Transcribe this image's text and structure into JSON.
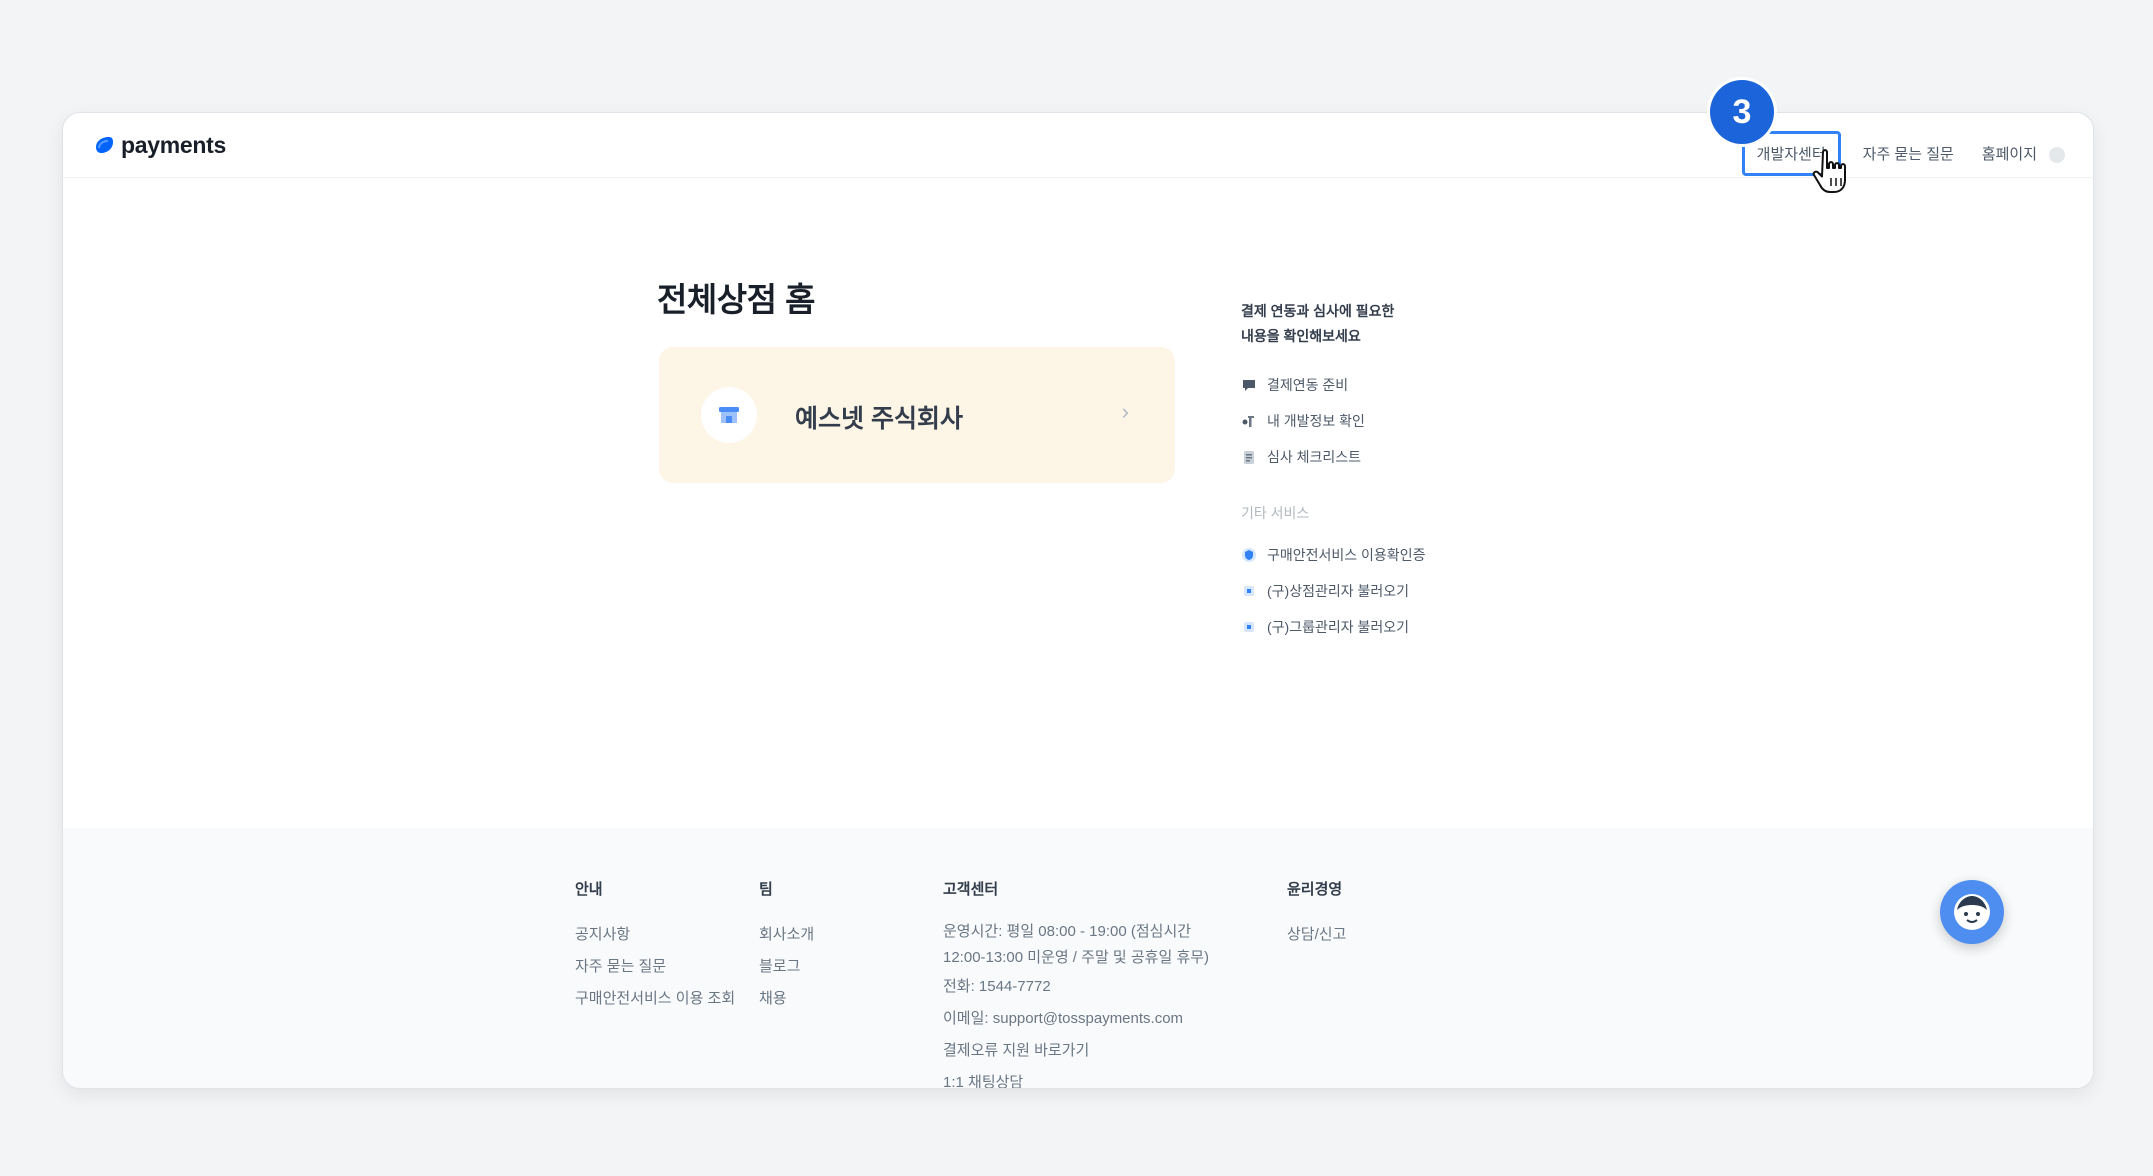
{
  "brand": {
    "logo_text": "payments",
    "logo_icon": "toss-drop-icon",
    "accent": "#3182f6"
  },
  "nav": {
    "items": [
      {
        "label": "개발자센터",
        "highlighted": true
      },
      {
        "label": "자주 묻는 질문"
      },
      {
        "label": "홈페이지"
      }
    ],
    "profile_icon": "user-avatar-icon"
  },
  "tutorial": {
    "step": "3",
    "badge_color": "#1b64da"
  },
  "main": {
    "title": "전체상점 홈",
    "store_card": {
      "name": "예스넷 주식회사",
      "icon": "store-icon",
      "chevron": "›",
      "bg": "#fdf5e6"
    }
  },
  "side": {
    "heading_line1": "결제 연동과 심사에 필요한",
    "heading_line2": "내용을 확인해보세요",
    "items": [
      {
        "label": "결제연동 준비",
        "icon": "chat-bubble-icon"
      },
      {
        "label": "내 개발정보 확인",
        "icon": "key-icon"
      },
      {
        "label": "심사 체크리스트",
        "icon": "clipboard-icon"
      }
    ],
    "other_heading": "기타 서비스",
    "other_items": [
      {
        "label": "구매안전서비스 이용확인증",
        "icon": "shield-icon"
      },
      {
        "label": "(구)상점관리자 불러오기",
        "icon": "import-icon"
      },
      {
        "label": "(구)그룹관리자 불러오기",
        "icon": "import-icon"
      }
    ]
  },
  "footer": {
    "col1": {
      "title": "안내",
      "links": [
        "공지사항",
        "자주 묻는 질문",
        "구매안전서비스 이용 조회"
      ]
    },
    "col2": {
      "title": "팀",
      "links": [
        "회사소개",
        "블로그",
        "채용"
      ]
    },
    "col3": {
      "title": "고객센터",
      "hours_line1": "운영시간: 평일 08:00 - 19:00 (점심시간",
      "hours_line2": "12:00-13:00 미운영 / 주말 및 공휴일 휴무)",
      "phone": "전화: 1544-7772",
      "email": "이메일: support@tosspayments.com",
      "error_support": "결제오류 지원 바로가기",
      "chat": "1:1 채팅상담"
    },
    "col4": {
      "title": "윤리경영",
      "links": [
        "상담/신고"
      ]
    }
  },
  "chatbot": {
    "icon": "chatbot-face-icon"
  }
}
